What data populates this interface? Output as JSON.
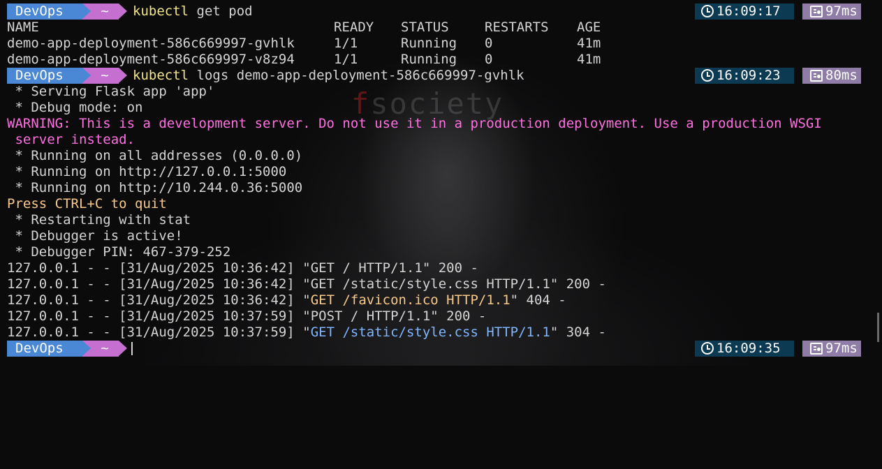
{
  "prompts": [
    {
      "user": "DevOps",
      "dir": "~",
      "cmd_prefix": "kubectl",
      "cmd_rest": " get pod",
      "time": "16:09:17",
      "duration": "97ms"
    },
    {
      "user": "DevOps",
      "dir": "~",
      "cmd_prefix": "kubectl",
      "cmd_rest": " logs demo-app-deployment-586c669997-gvhlk",
      "time": "16:09:23",
      "duration": "80ms"
    },
    {
      "user": "DevOps",
      "dir": "~",
      "cmd_prefix": "",
      "cmd_rest": "",
      "time": "16:09:35",
      "duration": "97ms"
    }
  ],
  "pod_table": {
    "headers": [
      "NAME",
      "READY",
      "STATUS",
      "RESTARTS",
      "AGE"
    ],
    "rows": [
      [
        "demo-app-deployment-586c669997-gvhlk",
        "1/1",
        "Running",
        "0",
        "41m"
      ],
      [
        "demo-app-deployment-586c669997-v8z94",
        "1/1",
        "Running",
        "0",
        "41m"
      ]
    ]
  },
  "logs": {
    "serving": " * Serving Flask app 'app'",
    "debug_mode": " * Debug mode: on",
    "warning_1": "WARNING: This is a development server. Do not use it in a production deployment. Use a production WSGI",
    "warning_2": " server instead.",
    "running_all": " * Running on all addresses (0.0.0.0)",
    "running_local": " * Running on http://127.0.0.1:5000",
    "running_pod": " * Running on http://10.244.0.36:5000",
    "quit": "Press CTRL+C to quit",
    "restarting": " * Restarting with stat",
    "debugger_active": " * Debugger is active!",
    "debugger_pin": " * Debugger PIN: 467-379-252",
    "requests": [
      {
        "prefix": "127.0.0.1 - - [31/Aug/2025 10:36:42] \"",
        "request": "GET / HTTP/1.1",
        "suffix": "\" 200 -",
        "color": "plain"
      },
      {
        "prefix": "127.0.0.1 - - [31/Aug/2025 10:36:42] \"",
        "request": "GET /static/style.css HTTP/1.1",
        "suffix": "\" 200 -",
        "color": "plain"
      },
      {
        "prefix": "127.0.0.1 - - [31/Aug/2025 10:36:42] \"",
        "request": "GET /favicon.ico HTTP/1.1",
        "suffix": "\" 404 -",
        "color": "orange"
      },
      {
        "prefix": "127.0.0.1 - - [31/Aug/2025 10:37:59] \"",
        "request": "POST / HTTP/1.1",
        "suffix": "\" 200 -",
        "color": "plain"
      },
      {
        "prefix": "127.0.0.1 - - [31/Aug/2025 10:37:59] \"",
        "request": "GET /static/style.css HTTP/1.1",
        "suffix": "\" 304 -",
        "color": "blue"
      }
    ]
  },
  "background_logo": {
    "first": "f",
    "rest": "society"
  },
  "colors": {
    "user_segment": "#4a88d6",
    "dir_segment": "#c56fd1",
    "time_segment": "#0b3a52",
    "duration_segment": "#8f7ca7",
    "command": "#f2e58a",
    "warning": "#ff6fe0",
    "quit": "#f9c98a",
    "status_404": "#f9c98a",
    "status_304": "#7fb6ff"
  },
  "icons": {
    "time": "clock-icon",
    "duration": "stopwatch-icon"
  }
}
